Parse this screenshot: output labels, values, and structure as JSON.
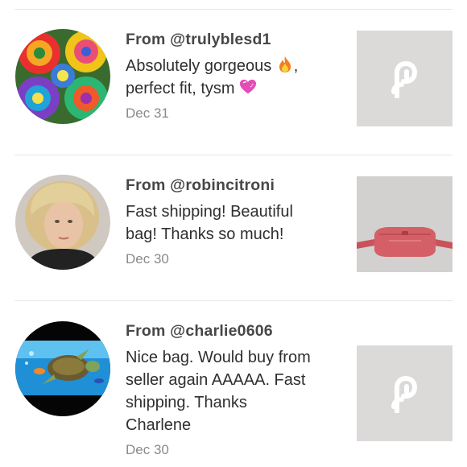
{
  "reviews": [
    {
      "from": "From @trulyblesd1",
      "text_a": "Absolutely gorgeous",
      "text_b": ",",
      "text_c": "perfect fit, tysm",
      "date": "Dec 31",
      "avatar": "rainbow-roses-avatar",
      "thumbnail": "poshmark-logo"
    },
    {
      "from": "From @robincitroni",
      "text_lines": [
        "Fast shipping! Beautiful",
        "bag! Thanks so much!"
      ],
      "date": "Dec 30",
      "avatar": "woman-blonde-hair-avatar",
      "thumbnail": "pink-belt-bag"
    },
    {
      "from": "From @charlie0606",
      "text_lines": [
        "Nice bag. Would buy from",
        "seller again AAAAA. Fast",
        "shipping. Thanks",
        "Charlene"
      ],
      "date": "Dec 30",
      "avatar": "sea-turtle-avatar",
      "thumbnail": "poshmark-logo"
    }
  ],
  "colors": {
    "thumb_bg": "#dcdad9",
    "logo": "#ffffff",
    "bag": "#d45f66"
  }
}
